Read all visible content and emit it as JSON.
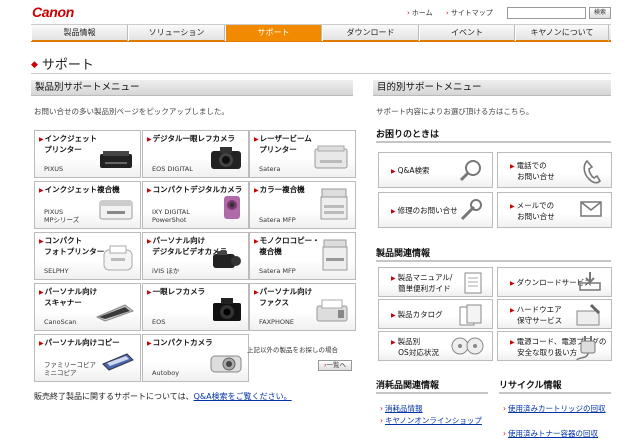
{
  "header": {
    "logo": "Canon",
    "home_link": "ホーム",
    "sitemap_link": "サイトマップ",
    "search_placeholder": "",
    "search_button": "検索"
  },
  "nav": {
    "tabs": [
      "製品情報",
      "ソリューション",
      "サポート",
      "ダウンロード",
      "イベント",
      "キヤノンについて"
    ],
    "active_index": 2
  },
  "page_title": "サポート",
  "left": {
    "section_title": "製品別サポートメニュー",
    "lead": "お問い合せの多い製品別ページをピックアップしました。",
    "cards": [
      {
        "title": [
          "インクジェット",
          "プリンター"
        ],
        "sub": [
          "PIXUS"
        ],
        "icon": "inkjet-printer-icon"
      },
      {
        "title": [
          "デジタル一眼レフカメラ"
        ],
        "sub": [
          "EOS DIGITAL"
        ],
        "icon": "dslr-camera-icon"
      },
      {
        "title": [
          "レーザービーム",
          "プリンター"
        ],
        "sub": [
          "Satera"
        ],
        "icon": "laser-printer-icon"
      },
      {
        "title": [
          "インクジェット複合機"
        ],
        "sub": [
          "PIXUS",
          "MPシリーズ"
        ],
        "icon": "inkjet-mfp-icon"
      },
      {
        "title": [
          "コンパクトデジタルカメラ"
        ],
        "sub": [
          "IXY DIGITAL",
          "PowerShot"
        ],
        "icon": "compact-camera-icon"
      },
      {
        "title": [
          "カラー複合機"
        ],
        "sub": [
          "Satera MFP"
        ],
        "icon": "color-mfp-icon"
      },
      {
        "title": [
          "コンパクト",
          "フォトプリンター"
        ],
        "sub": [
          "SELPHY"
        ],
        "icon": "photo-printer-icon"
      },
      {
        "title": [
          "パーソナル向け",
          "デジタルビデオカメラ"
        ],
        "sub": [
          "iVIS ほか"
        ],
        "icon": "video-camera-icon"
      },
      {
        "title": [
          "モノクロコピー・",
          "複合機"
        ],
        "sub": [
          "Satera MFP"
        ],
        "icon": "mono-mfp-icon"
      },
      {
        "title": [
          "パーソナル向け",
          "スキャナー"
        ],
        "sub": [
          "CanoScan"
        ],
        "icon": "scanner-icon"
      },
      {
        "title": [
          "一眼レフカメラ"
        ],
        "sub": [
          "EOS"
        ],
        "icon": "slr-camera-icon"
      },
      {
        "title": [
          "パーソナル向け",
          "ファクス"
        ],
        "sub": [
          "FAXPHONE"
        ],
        "icon": "fax-icon"
      },
      {
        "title": [
          "パーソナル向けコピー"
        ],
        "sub": [
          "ファミリーコピア",
          "ミニコピア"
        ],
        "icon": "personal-copier-icon"
      },
      {
        "title": [
          "コンパクトカメラ"
        ],
        "sub": [
          "Autoboy"
        ],
        "icon": "film-camera-icon"
      }
    ],
    "other_note": "上記以外の製品をお探しの場合",
    "list_button": "一覧へ",
    "discontinued_prefix": "販売終了製品に関するサポートについては、",
    "discontinued_link": "Q&A検索をご覧ください。"
  },
  "right": {
    "section_title": "目的別サポートメニュー",
    "lead": "サポート内容によりお選び頂ける方はこちら。",
    "trouble_title": "お困りのときは",
    "trouble_buttons": [
      {
        "label": [
          "Q&A検索"
        ],
        "icon": "search-icon"
      },
      {
        "label": [
          "電話での",
          "お問い合せ"
        ],
        "icon": "phone-icon"
      },
      {
        "label": [
          "修理のお問い合せ"
        ],
        "icon": "wrench-icon"
      },
      {
        "label": [
          "メールでの",
          "お問い合せ"
        ],
        "icon": "mail-icon"
      }
    ],
    "product_info_title": "製品関連情報",
    "product_buttons": [
      {
        "label": [
          "製品マニュアル/",
          "簡単便利ガイド"
        ],
        "icon": "manual-icon"
      },
      {
        "label": [
          "ダウンロードサービス"
        ],
        "icon": "download-icon"
      },
      {
        "label": [
          "製品カタログ"
        ],
        "icon": "catalog-icon"
      },
      {
        "label": [
          "ハードウエア",
          "保守サービス"
        ],
        "icon": "maintenance-icon"
      },
      {
        "label": [
          "製品別",
          "OS対応状況"
        ],
        "icon": "disc-icon"
      },
      {
        "label": [
          "電源コード、電源プラグの",
          "安全な取り扱い方"
        ],
        "icon": "power-plug-icon"
      }
    ],
    "consumables_title": "消耗品関連情報",
    "consumables_links": [
      "消耗品情報",
      "キヤノンオンラインショップ"
    ],
    "recycle_title": "リサイクル情報",
    "recycle_links": [
      "使用済みカートリッジの回収",
      "使用済みトナー容器の回収"
    ]
  }
}
